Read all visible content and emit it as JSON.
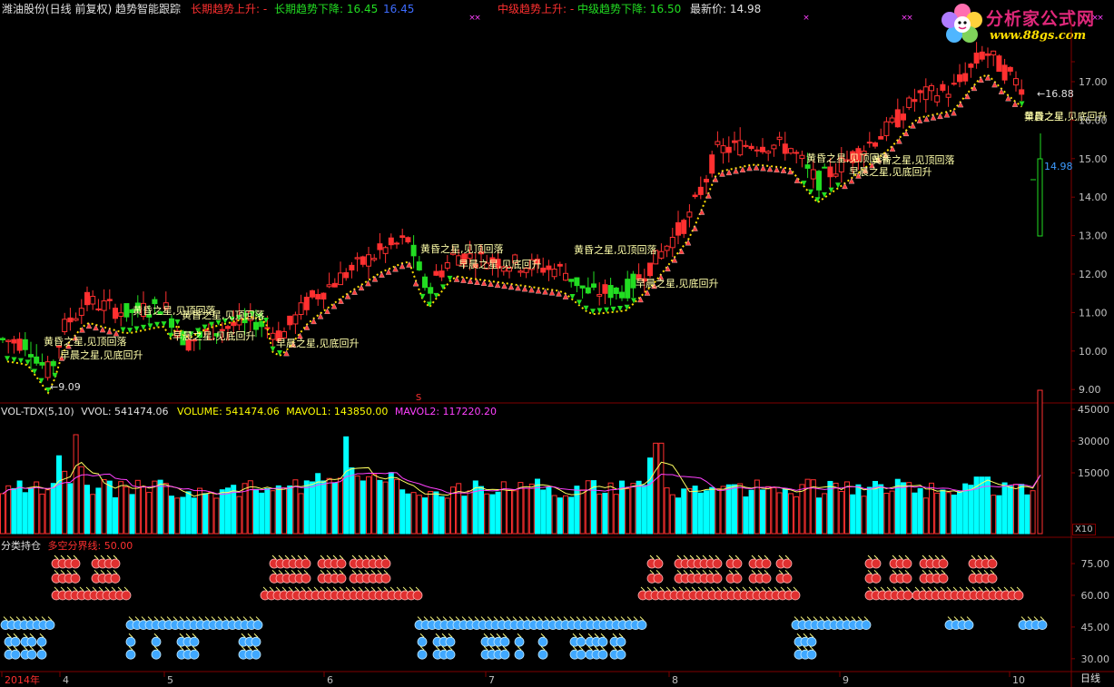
{
  "header": {
    "title": "潍油股份(日线 前复权) 趋势智能跟踪",
    "long_up": "长期趋势上升: -",
    "long_down": "长期趋势下降: 16.45",
    "long_blue": "16.45",
    "mid_up": "中级趋势上升: -",
    "mid_down": "中级趋势下降: 16.50",
    "last_price": "最新价: 14.98"
  },
  "logo": {
    "line1": "分析家公式网",
    "line2": "www.88gs.com"
  },
  "price_panel": {
    "axis_ticks": [
      "17.00",
      "16.00",
      "15.00",
      "14.00",
      "13.00",
      "12.00",
      "11.00",
      "10.00",
      "9.00"
    ],
    "low_label": "9.09",
    "high_label": "16.88",
    "last_label": "14.98",
    "marker_s": "S",
    "annotations": [
      {
        "text": "黄昏之星,见顶回落",
        "kind": "top"
      },
      {
        "text": "早晨之星,见底回升",
        "kind": "bottom"
      },
      {
        "text": "黄昏之星,见顶回落",
        "kind": "top"
      },
      {
        "text": "早晨之星,见底回升",
        "kind": "bottom"
      },
      {
        "text": "黄昏之星,见顶回落",
        "kind": "top"
      },
      {
        "text": "早晨之星,见底回升",
        "kind": "bottom"
      },
      {
        "text": "黄昏之星,见顶回落",
        "kind": "top"
      },
      {
        "text": "早晨之星,见底回升",
        "kind": "bottom"
      },
      {
        "text": "黄昏之星,见顶回落",
        "kind": "top"
      },
      {
        "text": "早晨之星,见底回升",
        "kind": "bottom"
      },
      {
        "text": "黄昏之星,见顶回落",
        "kind": "top"
      },
      {
        "text": "早晨之星,见底回升",
        "kind": "bottom"
      },
      {
        "text": "黄昏之星,见顶回落",
        "kind": "top"
      },
      {
        "text": "早晨之星,见底回升",
        "kind": "bottom"
      },
      {
        "text": "黄昏之星",
        "kind": "top"
      }
    ]
  },
  "volume_panel": {
    "name": "VOL-TDX(5,10)",
    "vvol": "VVOL: 541474.06",
    "volume": "VOLUME: 541474.06",
    "mavol1": "MAVOL1: 143850.00",
    "mavol2": "MAVOL2: 117220.20",
    "axis_ticks": [
      "45000",
      "30000",
      "15000"
    ],
    "unit": "X10"
  },
  "position_panel": {
    "name": "分类持仓",
    "divider": "多空分界线: 50.00",
    "axis_ticks": [
      "75.00",
      "60.00",
      "45.00",
      "30.00"
    ],
    "glyph_long": "犬",
    "glyph_mid": "中",
    "glyph_short": "大"
  },
  "time_axis": {
    "labels": [
      "2014年",
      "4",
      "5",
      "6",
      "7",
      "8",
      "9",
      "10"
    ],
    "period": "日线"
  },
  "colors": {
    "background": "#000000",
    "up": "#ff3030",
    "down": "#00ffff",
    "green": "#22dd22",
    "yellow": "#ffff00",
    "magenta": "#ff40ff",
    "grid": "#800000",
    "axis_text": "#c0c0c0"
  }
}
